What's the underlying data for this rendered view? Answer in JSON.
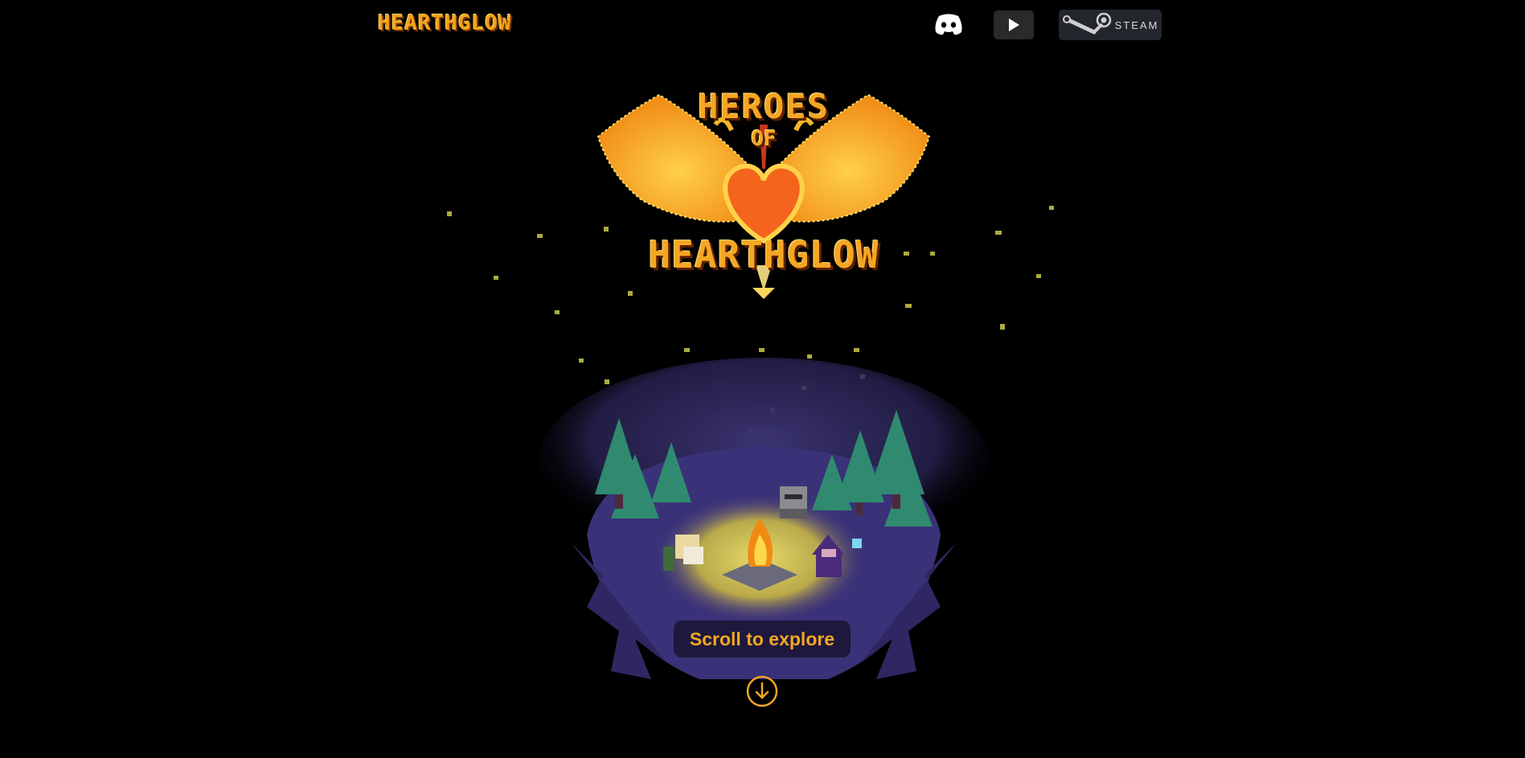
{
  "header": {
    "brand": "HEARTHGLOW",
    "discord_icon": "discord-icon",
    "youtube_icon": "play-icon",
    "steam_label": "STEAM",
    "steam_icon": "steam-icon"
  },
  "hero": {
    "logo_top": "HEROES",
    "logo_mid": "OF",
    "logo_bottom": "HEARTHGLOW"
  },
  "scroll": {
    "label": "Scroll to explore",
    "icon": "arrow-down-circle-icon"
  },
  "colors": {
    "accent": "#f5a623",
    "background": "#000000"
  }
}
